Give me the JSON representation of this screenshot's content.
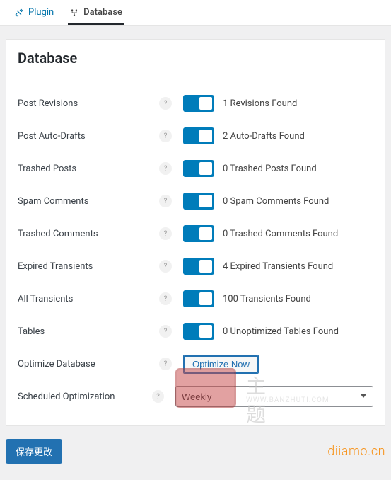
{
  "tabs": {
    "plugin": "Plugin",
    "database": "Database"
  },
  "page_title": "Database",
  "rows": [
    {
      "label": "Post Revisions",
      "result": "1 Revisions Found"
    },
    {
      "label": "Post Auto-Drafts",
      "result": "2 Auto-Drafts Found"
    },
    {
      "label": "Trashed Posts",
      "result": "0 Trashed Posts Found"
    },
    {
      "label": "Spam Comments",
      "result": "0 Spam Comments Found"
    },
    {
      "label": "Trashed Comments",
      "result": "0 Trashed Comments Found"
    },
    {
      "label": "Expired Transients",
      "result": "4 Expired Transients Found"
    },
    {
      "label": "All Transients",
      "result": "100 Transients Found"
    },
    {
      "label": "Tables",
      "result": "0 Unoptimized Tables Found"
    }
  ],
  "optimize": {
    "label": "Optimize Database",
    "button": "Optimize Now"
  },
  "schedule": {
    "label": "Scheduled Optimization",
    "selected": "Weekly"
  },
  "help_glyph": "?",
  "save_button": "保存更改",
  "brand": "diiamo.cn",
  "watermark": {
    "cn": "主题",
    "url": "WWW.BANZHUTI.COM"
  }
}
